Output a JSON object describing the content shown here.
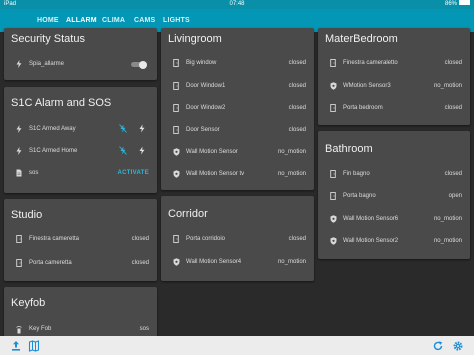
{
  "status_bar": {
    "device": "iPad",
    "time": "07:48",
    "battery": "86%"
  },
  "tabs": [
    {
      "label": "HOME",
      "active": false
    },
    {
      "label": "ALLARM",
      "active": true
    },
    {
      "label": "CLIMA",
      "active": false
    },
    {
      "label": "CAMS",
      "active": false
    },
    {
      "label": "LIGHTS",
      "active": false
    }
  ],
  "colors": {
    "accent": "#0396b5",
    "card_bg": "#4a4a4a",
    "page_bg": "#2a2a2a",
    "action": "#2fb7d8"
  },
  "cards": {
    "security_status": {
      "title": "Security Status",
      "rows": [
        {
          "icon": "bolt-icon",
          "name": "Spia_allarme",
          "toggle": "off"
        }
      ]
    },
    "s1c_alarm": {
      "title": "S1C Alarm and SOS",
      "rows": [
        {
          "icon": "bolt-icon",
          "name": "S1C Armed Away"
        },
        {
          "icon": "bolt-icon",
          "name": "S1C Armed Home"
        },
        {
          "icon": "document-icon",
          "name": "sos",
          "action": "ACTIVATE"
        }
      ]
    },
    "studio": {
      "title": "Studio",
      "rows": [
        {
          "icon": "door-icon",
          "name": "Finestra cameretta",
          "state": "closed"
        },
        {
          "icon": "door-icon",
          "name": "Porta cameretta",
          "state": "closed"
        }
      ]
    },
    "keyfob": {
      "title": "Keyfob",
      "rows": [
        {
          "icon": "remote-icon",
          "name": "Key Fob",
          "state": "sos"
        }
      ]
    },
    "livingroom": {
      "title": "Livingroom",
      "rows": [
        {
          "icon": "door-icon",
          "name": "Big window",
          "state": "closed"
        },
        {
          "icon": "door-icon",
          "name": "Door Window1",
          "state": "closed"
        },
        {
          "icon": "door-icon",
          "name": "Door Window2",
          "state": "closed"
        },
        {
          "icon": "door-icon",
          "name": "Door Sensor",
          "state": "closed"
        },
        {
          "icon": "shield-icon",
          "name": "Wall Motion Sensor",
          "state": "no_motion"
        },
        {
          "icon": "shield-icon",
          "name": "Wall Motion Sensor tv",
          "state": "no_motion"
        }
      ]
    },
    "corridor": {
      "title": "Corridor",
      "rows": [
        {
          "icon": "door-icon",
          "name": "Porta corridoio",
          "state": "closed"
        },
        {
          "icon": "shield-icon",
          "name": "Wall Motion Sensor4",
          "state": "no_motion"
        }
      ]
    },
    "materbedroom": {
      "title": "MaterBedroom",
      "rows": [
        {
          "icon": "door-icon",
          "name": "Finestra cameraletto",
          "state": "closed"
        },
        {
          "icon": "shield-icon",
          "name": "WMotion Sensor3",
          "state": "no_motion"
        },
        {
          "icon": "door-icon",
          "name": "Porta bedroom",
          "state": "closed"
        }
      ]
    },
    "bathroom": {
      "title": "Bathroom",
      "rows": [
        {
          "icon": "door-icon",
          "name": "Fin bagno",
          "state": "closed"
        },
        {
          "icon": "door-icon",
          "name": "Porta bagno",
          "state": "open"
        },
        {
          "icon": "shield-icon",
          "name": "Wall Motion Sensor6",
          "state": "no_motion"
        },
        {
          "icon": "shield-icon",
          "name": "Wall Motion Sensor2",
          "state": "no_motion"
        }
      ]
    }
  },
  "bottom_bar": {
    "left": [
      "share-icon",
      "book-icon"
    ],
    "right": [
      "refresh-icon",
      "settings-icon"
    ]
  }
}
